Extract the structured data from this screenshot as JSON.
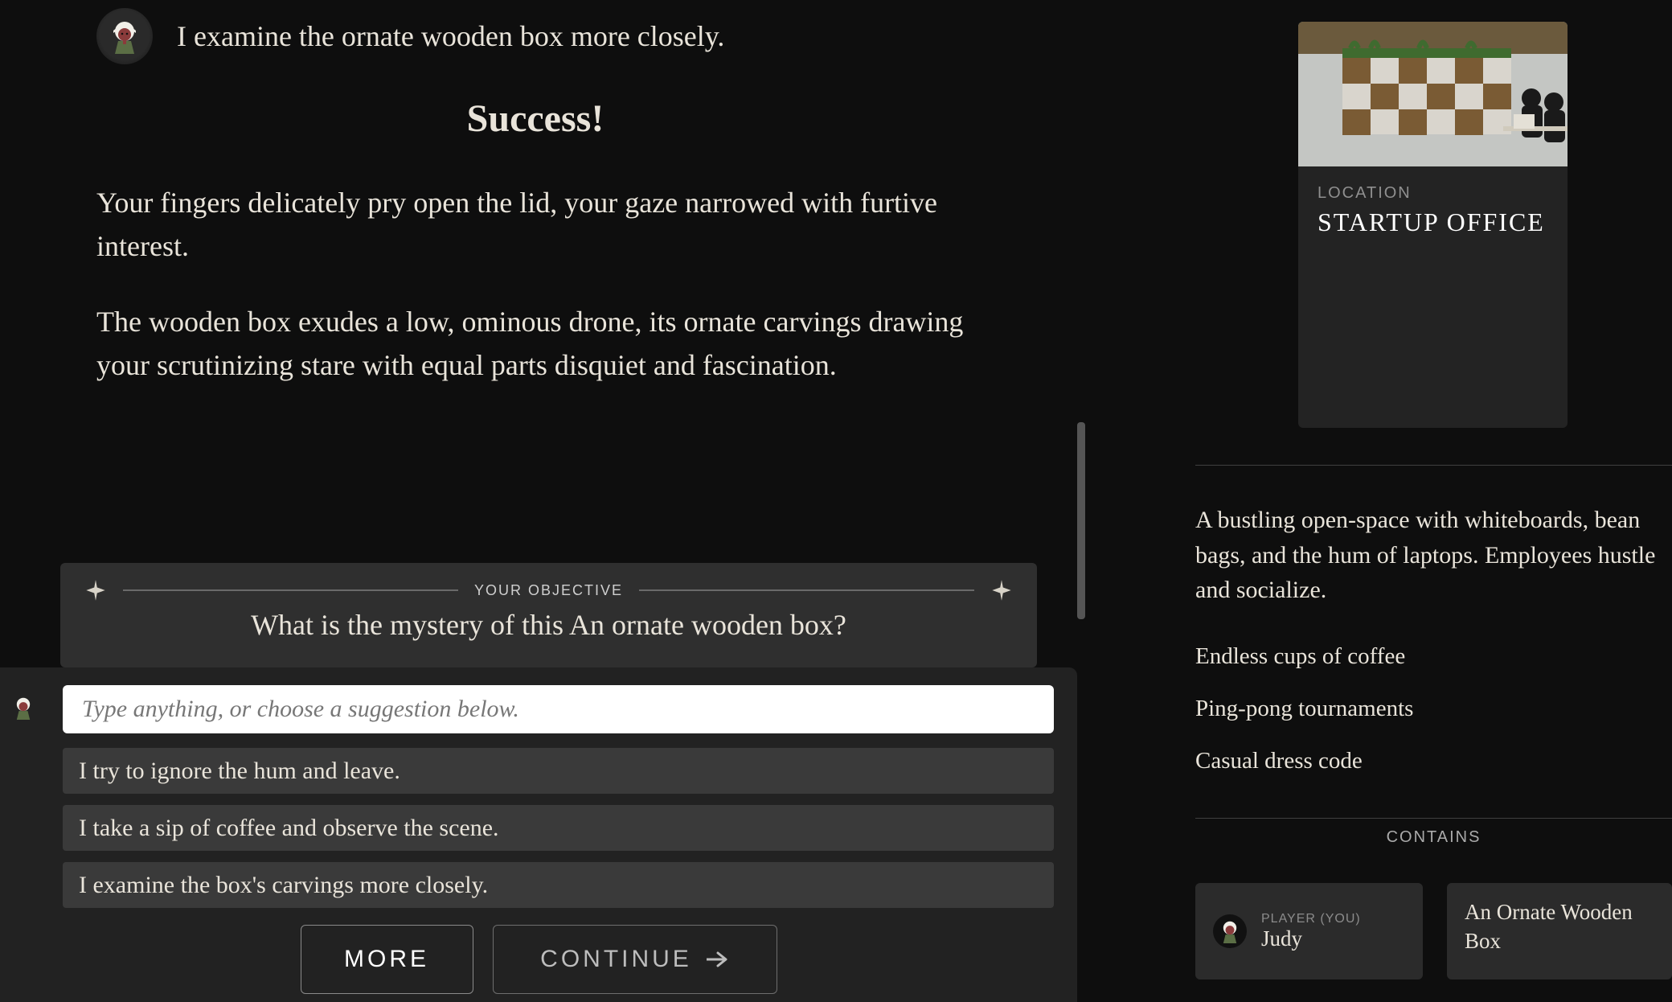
{
  "player": {
    "name": "Judy",
    "last_action": "I examine the ornate wooden box more closely."
  },
  "result": {
    "heading": "Success!"
  },
  "narration": {
    "p1": "Your fingers delicately pry open the lid, your gaze narrowed with furtive interest.",
    "p2": "The wooden box exudes a low, ominous drone, its ornate carvings drawing your scrutinizing stare with equal parts disquiet and fascination."
  },
  "objective": {
    "label": "YOUR OBJECTIVE",
    "text": "What is the mystery of this An ornate wooden box?"
  },
  "input": {
    "placeholder": "Type anything, or choose a suggestion below."
  },
  "suggestions": {
    "s1": "I try to ignore the hum and leave.",
    "s2": "I take a sip of coffee and observe the scene.",
    "s3": "I examine the box's carvings more closely."
  },
  "buttons": {
    "more": "MORE",
    "continue": "CONTINUE"
  },
  "location": {
    "label": "LOCATION",
    "name": "STARTUP OFFICE",
    "description": "A bustling open-space with whiteboards, bean bags, and the hum of laptops. Employees hustle and socialize.",
    "bullets": {
      "b1": "Endless cups of coffee",
      "b2": "Ping-pong tournaments",
      "b3": "Casual dress code"
    }
  },
  "contains": {
    "label": "CONTAINS",
    "player_tag": "PLAYER (YOU)",
    "player_name": "Judy",
    "item_name": "An Ornate Wooden Box"
  }
}
